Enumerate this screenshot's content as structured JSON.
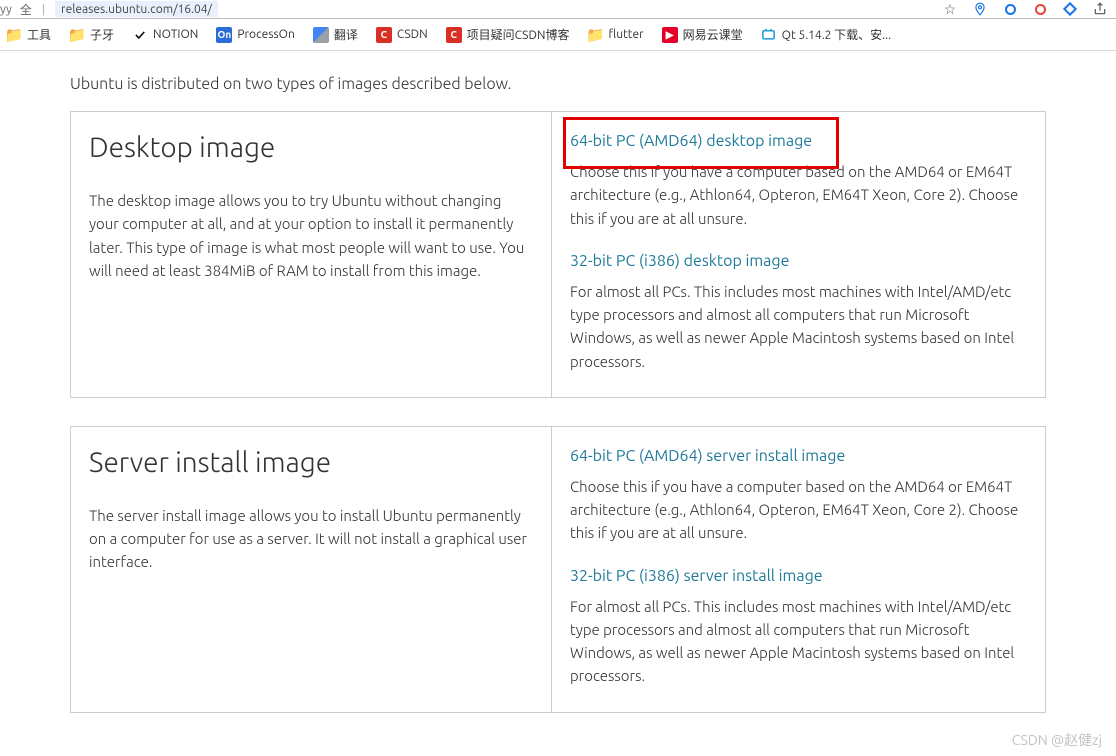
{
  "browser": {
    "left_label": "yy",
    "security_label": "全",
    "url": "releases.ubuntu.com/16.04/"
  },
  "bookmarks": [
    {
      "label": "工具",
      "icon": "folder"
    },
    {
      "label": "子牙",
      "icon": "folder"
    },
    {
      "label": "NOTION",
      "icon": "notion"
    },
    {
      "label": "ProcessOn",
      "icon": "box-blue",
      "icon_text": "On"
    },
    {
      "label": "翻译",
      "icon": "gtrans"
    },
    {
      "label": "CSDN",
      "icon": "box-red",
      "icon_text": "C"
    },
    {
      "label": "项目疑问CSDN博客",
      "icon": "box-red",
      "icon_text": "C"
    },
    {
      "label": "flutter",
      "icon": "flutter"
    },
    {
      "label": "网易云课堂",
      "icon": "netease",
      "icon_text": "▶"
    },
    {
      "label": "Qt 5.14.2 下载、安...",
      "icon": "qt"
    }
  ],
  "intro": "Ubuntu is distributed on two types of images described below.",
  "sections": [
    {
      "title": "Desktop image",
      "desc": "The desktop image allows you to try Ubuntu without changing your computer at all, and at your option to install it permanently later. This type of image is what most people will want to use. You will need at least 384MiB of RAM to install from this image.",
      "downloads": [
        {
          "link": "64-bit PC (AMD64) desktop image",
          "desc": "Choose this if you have a computer based on the AMD64 or EM64T architecture (e.g., Athlon64, Opteron, EM64T Xeon, Core 2). Choose this if you are at all unsure."
        },
        {
          "link": "32-bit PC (i386) desktop image",
          "desc": "For almost all PCs. This includes most machines with Intel/AMD/etc type processors and almost all computers that run Microsoft Windows, as well as newer Apple Macintosh systems based on Intel processors."
        }
      ]
    },
    {
      "title": "Server install image",
      "desc": "The server install image allows you to install Ubuntu permanently on a computer for use as a server. It will not install a graphical user interface.",
      "downloads": [
        {
          "link": "64-bit PC (AMD64) server install image",
          "desc": "Choose this if you have a computer based on the AMD64 or EM64T architecture (e.g., Athlon64, Opteron, EM64T Xeon, Core 2). Choose this if you are at all unsure."
        },
        {
          "link": "32-bit PC (i386) server install image",
          "desc": "For almost all PCs. This includes most machines with Intel/AMD/etc type processors and almost all computers that run Microsoft Windows, as well as newer Apple Macintosh systems based on Intel processors."
        }
      ]
    }
  ],
  "watermark": "CSDN @赵健zj"
}
